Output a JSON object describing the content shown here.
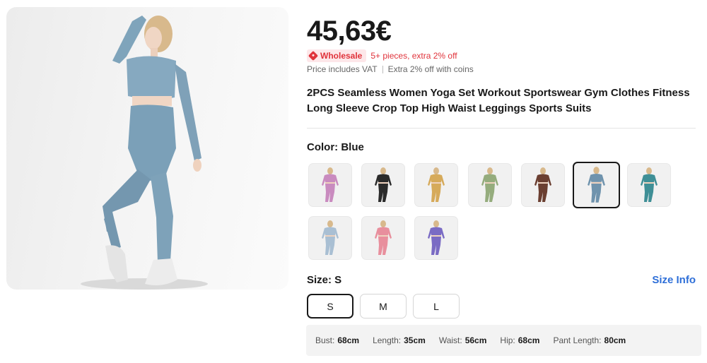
{
  "product": {
    "price": "45,63€",
    "wholesale_badge": "Wholesale",
    "wholesale_text": "5+ pieces, extra 2% off",
    "vat_text": "Price includes VAT",
    "coins_text": "Extra 2% off with coins",
    "title": "2PCS Seamless Women Yoga Set Workout Sportswear Gym Clothes Fitness Long Sleeve Crop Top High Waist Leggings Sports Suits",
    "main_image_alt": "Model in blue seamless yoga set"
  },
  "color": {
    "label": "Color: Blue",
    "swatches": [
      {
        "name": "pink",
        "color": "#c98bbf",
        "selected": false
      },
      {
        "name": "black",
        "color": "#2b2b2b",
        "selected": false
      },
      {
        "name": "mustard",
        "color": "#d6aa5a",
        "selected": false
      },
      {
        "name": "sage-green",
        "color": "#95ac7d",
        "selected": false
      },
      {
        "name": "brown",
        "color": "#6b3f31",
        "selected": false
      },
      {
        "name": "blue",
        "color": "#6f93ad",
        "selected": true
      },
      {
        "name": "teal",
        "color": "#3f8f96",
        "selected": false
      },
      {
        "name": "light-blue",
        "color": "#a9bfd3",
        "selected": false
      },
      {
        "name": "coral-pink",
        "color": "#e88f9d",
        "selected": false
      },
      {
        "name": "purple",
        "color": "#7a6bc4",
        "selected": false
      }
    ]
  },
  "size": {
    "label": "Size: S",
    "info_link": "Size Info",
    "options": [
      "S",
      "M",
      "L"
    ],
    "selected": "S"
  },
  "measurements": [
    {
      "label": "Bust:",
      "value": "68cm"
    },
    {
      "label": "Length:",
      "value": "35cm"
    },
    {
      "label": "Waist:",
      "value": "56cm"
    },
    {
      "label": "Hip:",
      "value": "68cm"
    },
    {
      "label": "Pant Length:",
      "value": "80cm"
    }
  ]
}
